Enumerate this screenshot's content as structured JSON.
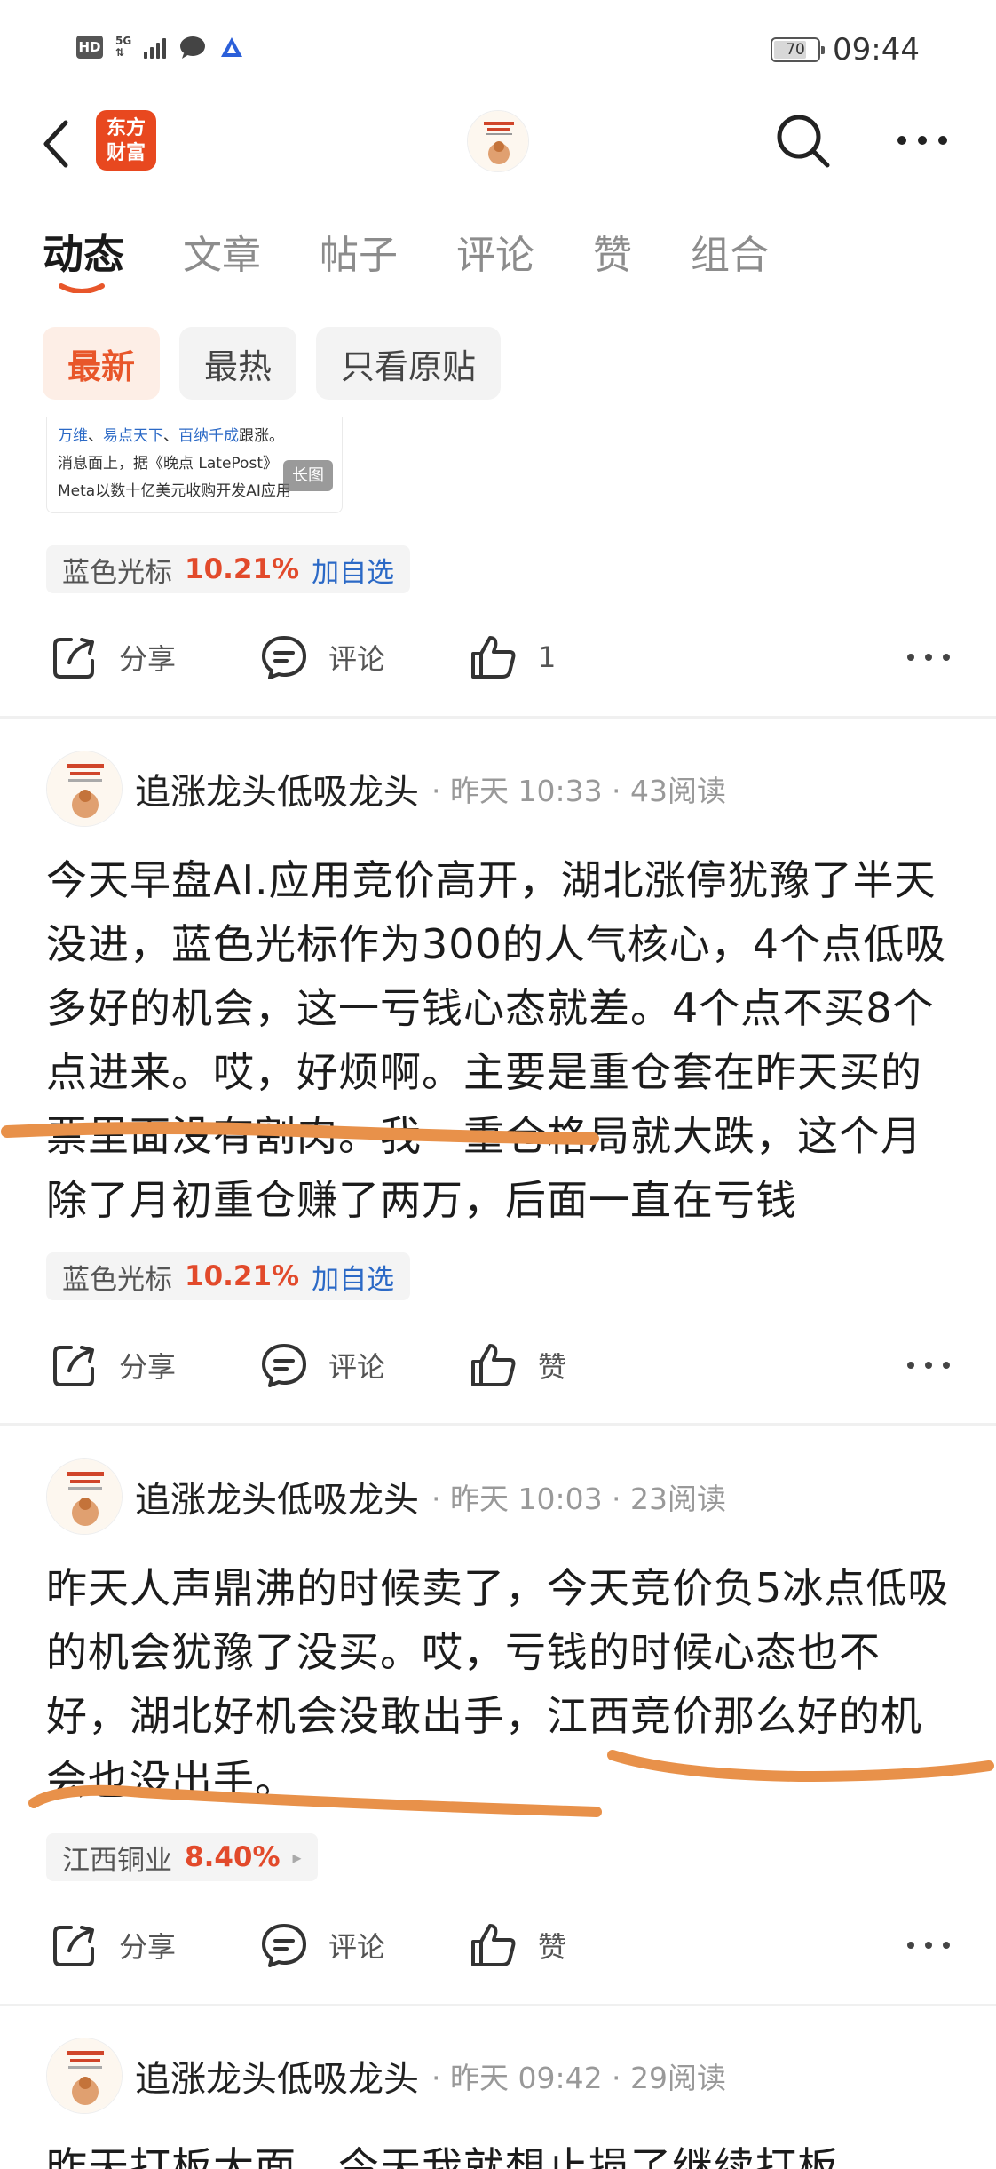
{
  "status_bar": {
    "network": "HD",
    "network_type": "5G",
    "battery": "70",
    "battery_level": 0.7,
    "time": "09:44"
  },
  "nav": {
    "logo_line1": "东方",
    "logo_line2": "财富"
  },
  "tabs": [
    "动态",
    "文章",
    "帖子",
    "评论",
    "赞",
    "组合"
  ],
  "filters": [
    "最新",
    "最热",
    "只看原贴"
  ],
  "image_preview": {
    "line1_links": [
      "万维",
      "易点天下",
      "百纳千成"
    ],
    "line1_sep": "、",
    "line1_tail": "跟涨。",
    "line2": "消息面上，据《晚点 LatePost》",
    "line3": "Meta以数十亿美元收购开发AI应用",
    "badge": "长图"
  },
  "posts": [
    {
      "stock": {
        "name": "蓝色光标",
        "pct": "10.21%",
        "action": "加自选"
      },
      "actions": {
        "share": "分享",
        "comment": "评论",
        "like": "1"
      }
    },
    {
      "author": "追涨龙头低吸龙头",
      "meta": "· 昨天 10:33 · 43阅读",
      "text": "今天早盘AI.应用竞价高开，湖北涨停犹豫了半天没进，蓝色光标作为300的人气核心，4个点低吸多好的机会，这一亏钱心态就差。4个点不买8个点进来。哎，好烦啊。主要是重仓套在昨天买的票里面没有割肉。我一重仓格局就大跌，这个月除了月初重仓赚了两万，后面一直在亏钱",
      "stock": {
        "name": "蓝色光标",
        "pct": "10.21%",
        "action": "加自选"
      },
      "actions": {
        "share": "分享",
        "comment": "评论",
        "like": "赞"
      }
    },
    {
      "author": "追涨龙头低吸龙头",
      "meta": "· 昨天 10:03 · 23阅读",
      "text": "昨天人声鼎沸的时候卖了，今天竞价负5冰点低吸的机会犹豫了没买。哎，亏钱的时候心态也不好，湖北好机会没敢出手，江西竞价那么好的机会也没出手。",
      "stock": {
        "name": "江西铜业",
        "pct": "8.40%",
        "arrow": "▸"
      },
      "actions": {
        "share": "分享",
        "comment": "评论",
        "like": "赞"
      }
    },
    {
      "author": "追涨龙头低吸龙头",
      "meta": "· 昨天 09:42 · 29阅读",
      "text": "昨天打板大面，今天我就想止损了继续打板"
    }
  ]
}
